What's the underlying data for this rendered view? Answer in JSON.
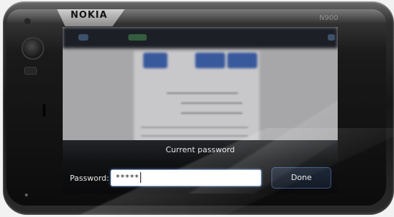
{
  "device": {
    "brand": "NOKIA",
    "model": "N900"
  },
  "dialog": {
    "title": "Current password",
    "password_label": "Password:",
    "password_value": "*****",
    "done_label": "Done"
  },
  "colors": {
    "accent": "#3e64b5",
    "field_focus": "#7b9ed4",
    "dialog_bg": "#111214",
    "text_light": "#e8e8e8"
  },
  "icons": [
    "camera-icon",
    "front-camera-icon",
    "proximity-sensor-icon",
    "stylus-slot-icon",
    "indicator-led-icon"
  ]
}
